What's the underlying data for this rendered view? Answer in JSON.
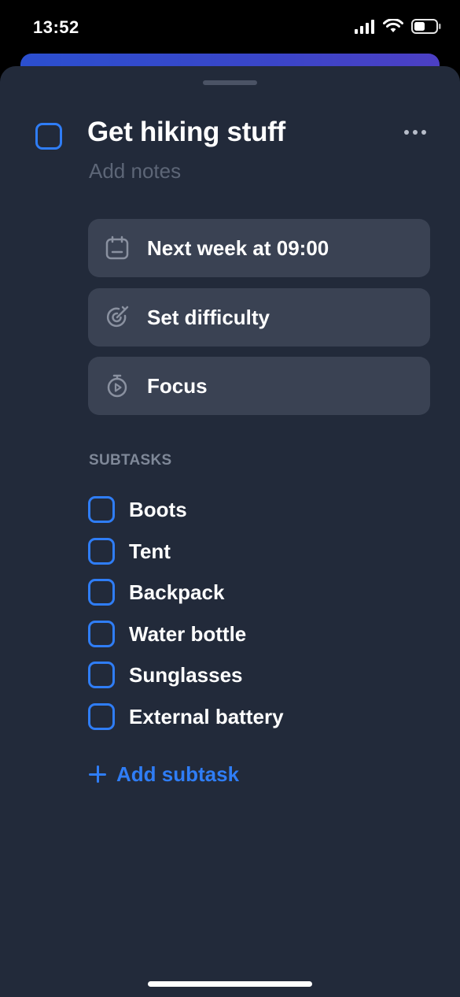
{
  "status_bar": {
    "time": "13:52",
    "signal_icon": "cellular-signal-icon",
    "wifi_icon": "wifi-icon",
    "battery_icon": "battery-icon",
    "battery_level": 0.5
  },
  "task": {
    "title": "Get hiking stuff",
    "notes_placeholder": "Add notes",
    "more_icon": "more-horizontal-icon"
  },
  "actions": [
    {
      "label": "Next week at 09:00",
      "icon": "calendar-icon"
    },
    {
      "label": "Set difficulty",
      "icon": "target-icon"
    },
    {
      "label": "Focus",
      "icon": "stopwatch-icon"
    }
  ],
  "subtasks": {
    "header": "SUBTASKS",
    "items": [
      {
        "label": "Boots"
      },
      {
        "label": "Tent"
      },
      {
        "label": "Backpack"
      },
      {
        "label": "Water bottle"
      },
      {
        "label": "Sunglasses"
      },
      {
        "label": "External battery"
      }
    ],
    "add_label": "Add subtask"
  },
  "colors": {
    "accent": "#2f7df6",
    "sheet_background": "#222a3a",
    "button_background": "#3a4253",
    "muted_text": "#5d6677",
    "section_header": "#7f8898"
  }
}
